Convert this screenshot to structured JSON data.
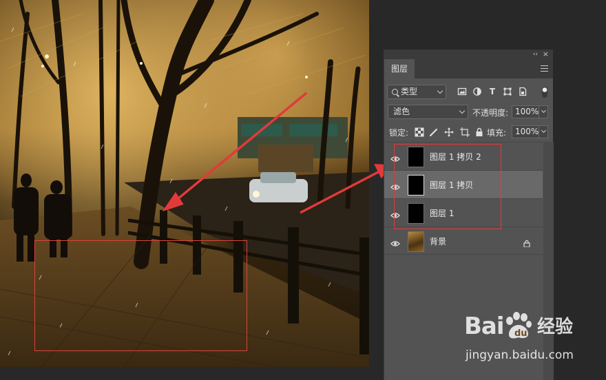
{
  "panel": {
    "tab_label": "图层",
    "collapse_glyph": "‹‹",
    "close_glyph": "×"
  },
  "filter": {
    "kind_label": "类型",
    "icons": [
      "image-filter-icon",
      "adjustment-filter-icon",
      "type-filter-icon",
      "shape-filter-icon",
      "smart-object-filter-icon",
      "filter-toggle-icon"
    ]
  },
  "blend": {
    "mode": "滤色",
    "opacity_label": "不透明度:",
    "opacity_value": "100%"
  },
  "lock": {
    "label": "锁定:",
    "icons": [
      "lock-transparent-pixels-icon",
      "lock-image-pixels-icon",
      "lock-position-icon",
      "lock-artboard-icon",
      "lock-all-icon"
    ],
    "fill_label": "填充:",
    "fill_value": "100%"
  },
  "layers": [
    {
      "name": "图层 1 拷贝 2",
      "visible": true,
      "active": false,
      "thumb": "black"
    },
    {
      "name": "图层 1 拷贝",
      "visible": true,
      "active": true,
      "thumb": "black"
    },
    {
      "name": "图层 1",
      "visible": true,
      "active": false,
      "thumb": "black"
    },
    {
      "name": "背景",
      "visible": true,
      "active": false,
      "thumb": "photo",
      "locked": true
    }
  ],
  "watermark": {
    "logo": "Bai  du",
    "product": "经验",
    "url": "jingyan.baidu.com"
  },
  "colors": {
    "annotation_red": "#e23a3a",
    "panel_bg": "#535353",
    "app_bg": "#282828"
  }
}
